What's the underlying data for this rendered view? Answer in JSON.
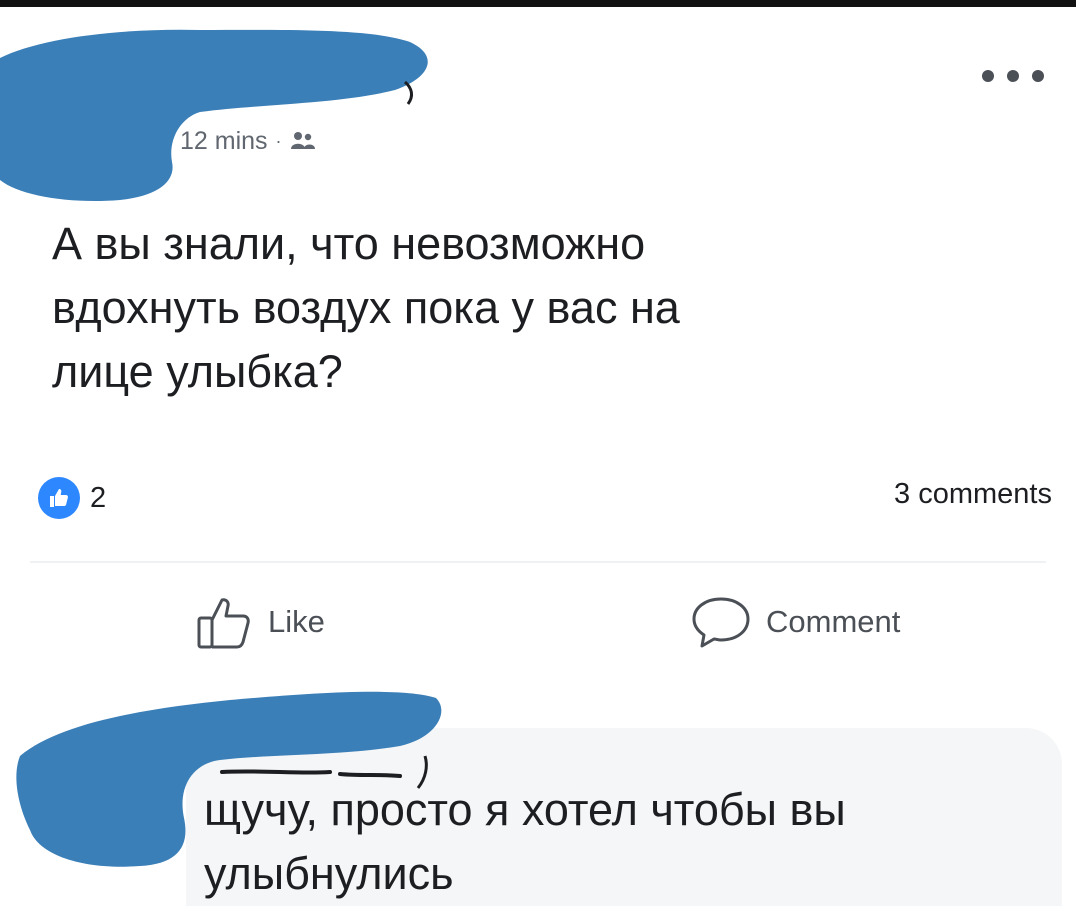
{
  "post": {
    "timestamp": "12 mins",
    "separator": "·",
    "audience_icon": "friends-icon",
    "text": "А вы знали, что невозможно\nвдохнуть воздух пока у вас на\nлице улыбка?",
    "more_icon": "more-options-icon"
  },
  "stats": {
    "reaction_icon": "like-icon",
    "reaction_count": "2",
    "comments": "3 comments"
  },
  "actions": {
    "like_label": "Like",
    "comment_label": "Comment"
  },
  "comment": {
    "text": "щучу, просто я хотел чтобы вы\nулыбнулись"
  },
  "colors": {
    "redaction": "#3b7fb8",
    "like_blue": "#2d88ff",
    "meta_gray": "#616770",
    "bubble": "#f5f6f7"
  }
}
